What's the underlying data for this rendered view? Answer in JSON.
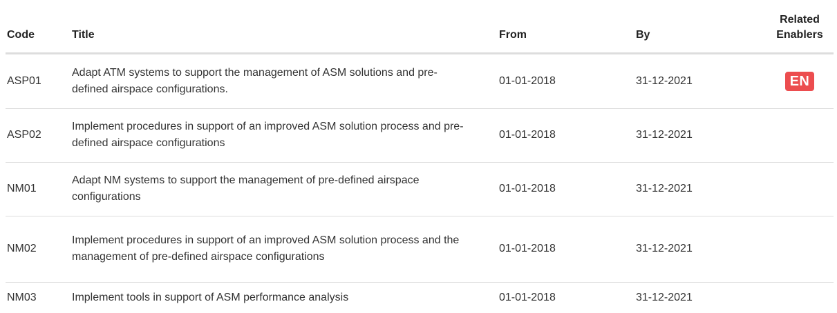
{
  "table": {
    "headers": {
      "code": "Code",
      "title": "Title",
      "from": "From",
      "by": "By",
      "related_line1": "Related",
      "related_line2": "Enablers"
    },
    "rows": [
      {
        "code": "ASP01",
        "title": "Adapt ATM systems to support the management of ASM solutions and pre-defined airspace configurations.",
        "from": "01-01-2018",
        "by": "31-12-2021",
        "enabler": "EN"
      },
      {
        "code": "ASP02",
        "title": "Implement procedures in support of an improved ASM solution process and pre-defined airspace configurations",
        "from": "01-01-2018",
        "by": "31-12-2021"
      },
      {
        "code": "NM01",
        "title": "Adapt NM systems to support the management of pre-defined airspace configurations",
        "from": "01-01-2018",
        "by": "31-12-2021"
      },
      {
        "code": "NM02",
        "title": "Implement procedures in support of an improved ASM solution process and the management of pre-defined airspace configurations",
        "from": "01-01-2018",
        "by": "31-12-2021"
      },
      {
        "code": "NM03",
        "title": "Implement tools in support of ASM performance analysis",
        "from": "01-01-2018",
        "by": "31-12-2021"
      }
    ]
  },
  "colors": {
    "enabler_badge": "#ec4d4f",
    "header_rule": "#dddddd",
    "row_rule": "#dddddd"
  }
}
